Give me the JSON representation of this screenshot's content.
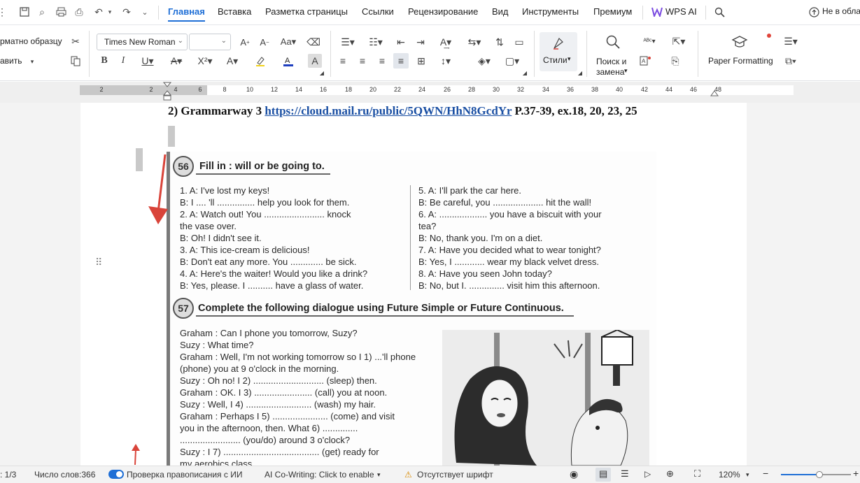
{
  "menu": {
    "tabs": [
      "Главная",
      "Вставка",
      "Разметка страницы",
      "Ссылки",
      "Рецензирование",
      "Вид",
      "Инструменты",
      "Премиум",
      "WPS AI"
    ],
    "active_tab": "Главная",
    "cloud_status": "Не в обла"
  },
  "ribbon": {
    "clipboard": {
      "format_painter": "рматно образцу",
      "paste": "авить"
    },
    "font_name": "Times New Roman",
    "font_size": "",
    "styles_label": "Стили",
    "find_label": "Поиск и",
    "find_label2": "замена",
    "paper_formatting": "Paper Formatting"
  },
  "ruler": {
    "ticks": [
      "2",
      "2",
      "4",
      "6",
      "8",
      "10",
      "12",
      "14",
      "16",
      "18",
      "20",
      "22",
      "24",
      "26",
      "28",
      "30",
      "32",
      "34",
      "36",
      "38",
      "40",
      "42",
      "44",
      "46",
      "48"
    ]
  },
  "document": {
    "heading_prefix": "2) Grammarway 3 ",
    "heading_link": "https://cloud.mail.ru/public/5QWN/HhN8GcdYr",
    "heading_suffix": " P.37-39, ex.18, 20, 23, 25",
    "ex56": {
      "num": "56",
      "title": "Fill in : will or be going to.",
      "left": [
        "1. A: I've lost my keys!",
        "    B: I .... 'll  ............... help you look for them.",
        "2. A: Watch out! You  ........................  knock",
        "        the vase over.",
        "    B: Oh! I didn't see it.",
        "3. A: This ice-cream is delicious!",
        "    B: Don't eat any more. You  .............  be sick.",
        "4. A: Here's the waiter! Would you like a drink?",
        "    B: Yes, please. I  ..........  have a glass of water."
      ],
      "right": [
        "5. A: I'll park the car here.",
        "    B: Be careful, you  ....................  hit the wall!",
        "6. A:  ...................  you have a biscuit with your",
        "        tea?",
        "    B: No, thank you. I'm on a diet.",
        "7. A: Have you decided what to wear tonight?",
        "    B: Yes, I  ............  wear my black velvet dress.",
        "8. A: Have you seen John today?",
        "    B: No, but I. ..............  visit him this afternoon."
      ]
    },
    "ex57": {
      "num": "57",
      "title": "Complete the following dialogue using Future Simple or Future Continuous.",
      "lines": [
        "Graham : Can I phone you tomorrow, Suzy?",
        "     Suzy : What time?",
        "Graham : Well, I'm not working tomorrow so I 1)  ...'ll phone",
        "                 (phone) you at 9 o'clock in the morning.",
        "     Suzy : Oh no! I 2)  ............................  (sleep) then.",
        "Graham :  OK. I 3)  .......................  (call) you at noon.",
        "     Suzy : Well, I 4)  ..........................  (wash) my hair.",
        "Graham : Perhaps I 5)  ......................  (come) and visit",
        "                 you in the afternoon, then. What 6)  ..............",
        "                 ........................  (you/do) around 3 o'clock?",
        "     Suzy : I 7)  ......................................  (get) ready for",
        "                 my aerobics class."
      ]
    }
  },
  "status": {
    "page": ": 1/3",
    "words": "Число слов:366",
    "spellcheck": "Проверка правописания с ИИ",
    "ai_cowriting": "AI Co-Writing: Click to enable",
    "missing_font": "Отсутствует шрифт",
    "zoom": "120%",
    "zoom_level": 0.55
  },
  "colors": {
    "accent": "#1f6fd6",
    "link": "#1a4fa3",
    "annotation_red": "#d9443a"
  }
}
